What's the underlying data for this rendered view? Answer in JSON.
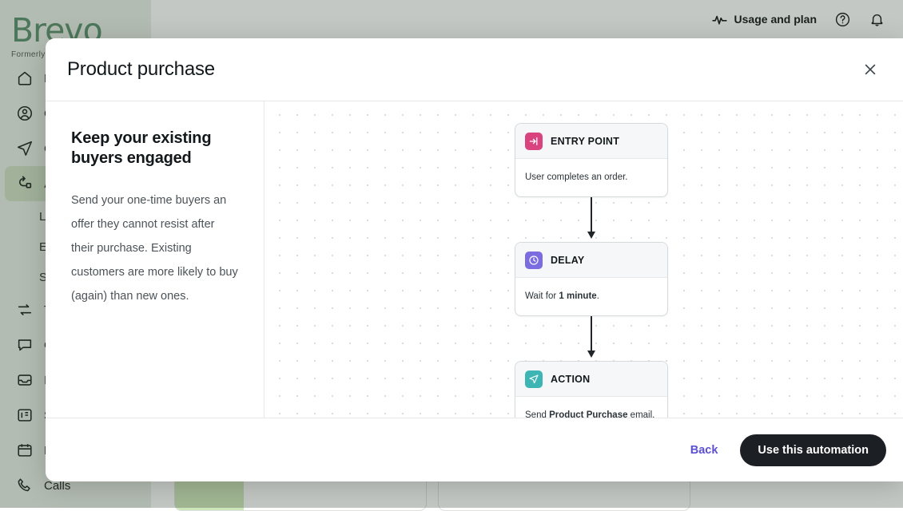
{
  "brand": {
    "name": "Brevo",
    "tagline": "Formerly sendinblue",
    "logo_color": "#5a8f6e"
  },
  "sidebar": {
    "items": [
      {
        "label": "Home",
        "icon": "home-icon",
        "active": false
      },
      {
        "label": "Contacts",
        "icon": "contacts-icon",
        "active": false
      },
      {
        "label": "Campaigns",
        "icon": "campaigns-icon",
        "active": false
      },
      {
        "label": "Automations",
        "icon": "automations-icon",
        "active": true
      },
      {
        "label": "Transactional",
        "icon": "transactional-icon",
        "active": false
      },
      {
        "label": "Conversations",
        "icon": "conversations-icon",
        "active": false
      },
      {
        "label": "Inbox",
        "icon": "inbox-icon",
        "active": false
      },
      {
        "label": "Sales platform",
        "icon": "sales-icon",
        "active": false
      },
      {
        "label": "Meetings",
        "icon": "meetings-icon",
        "active": false
      },
      {
        "label": "Calls",
        "icon": "calls-icon",
        "active": false
      }
    ],
    "sub_items": [
      {
        "label": "Logs"
      },
      {
        "label": "Emails"
      },
      {
        "label": "Settings"
      }
    ],
    "active_color": "#cfe0c5",
    "background": "#e8efe6"
  },
  "topbar": {
    "usage_label": "Usage and plan",
    "usage_icon": "activity-pulse-icon",
    "help_icon": "help-circle-icon",
    "notifications_icon": "bell-icon"
  },
  "modal": {
    "title": "Product purchase",
    "close_icon": "close-icon",
    "info": {
      "heading": "Keep your existing buyers engaged",
      "description": "Send your one-time buyers an offer they cannot resist after their purchase. Existing customers are more likely to buy (again) than new ones."
    },
    "flow": {
      "nodes": [
        {
          "type": "ENTRY POINT",
          "icon": "entry-point-icon",
          "icon_color": "#d9447f",
          "body_prefix": "User completes an order.",
          "body_bold": "",
          "body_suffix": ""
        },
        {
          "type": "DELAY",
          "icon": "clock-icon",
          "icon_color": "#7b6ce0",
          "body_prefix": "Wait for ",
          "body_bold": "1 minute",
          "body_suffix": "."
        },
        {
          "type": "ACTION",
          "icon": "send-icon",
          "icon_color": "#3db5b5",
          "body_prefix": "Send ",
          "body_bold": "Product Purchase",
          "body_suffix": " email."
        }
      ]
    },
    "footer": {
      "back_label": "Back",
      "back_color": "#5b50d6",
      "primary_label": "Use this automation",
      "primary_color": "#1c2024"
    }
  }
}
